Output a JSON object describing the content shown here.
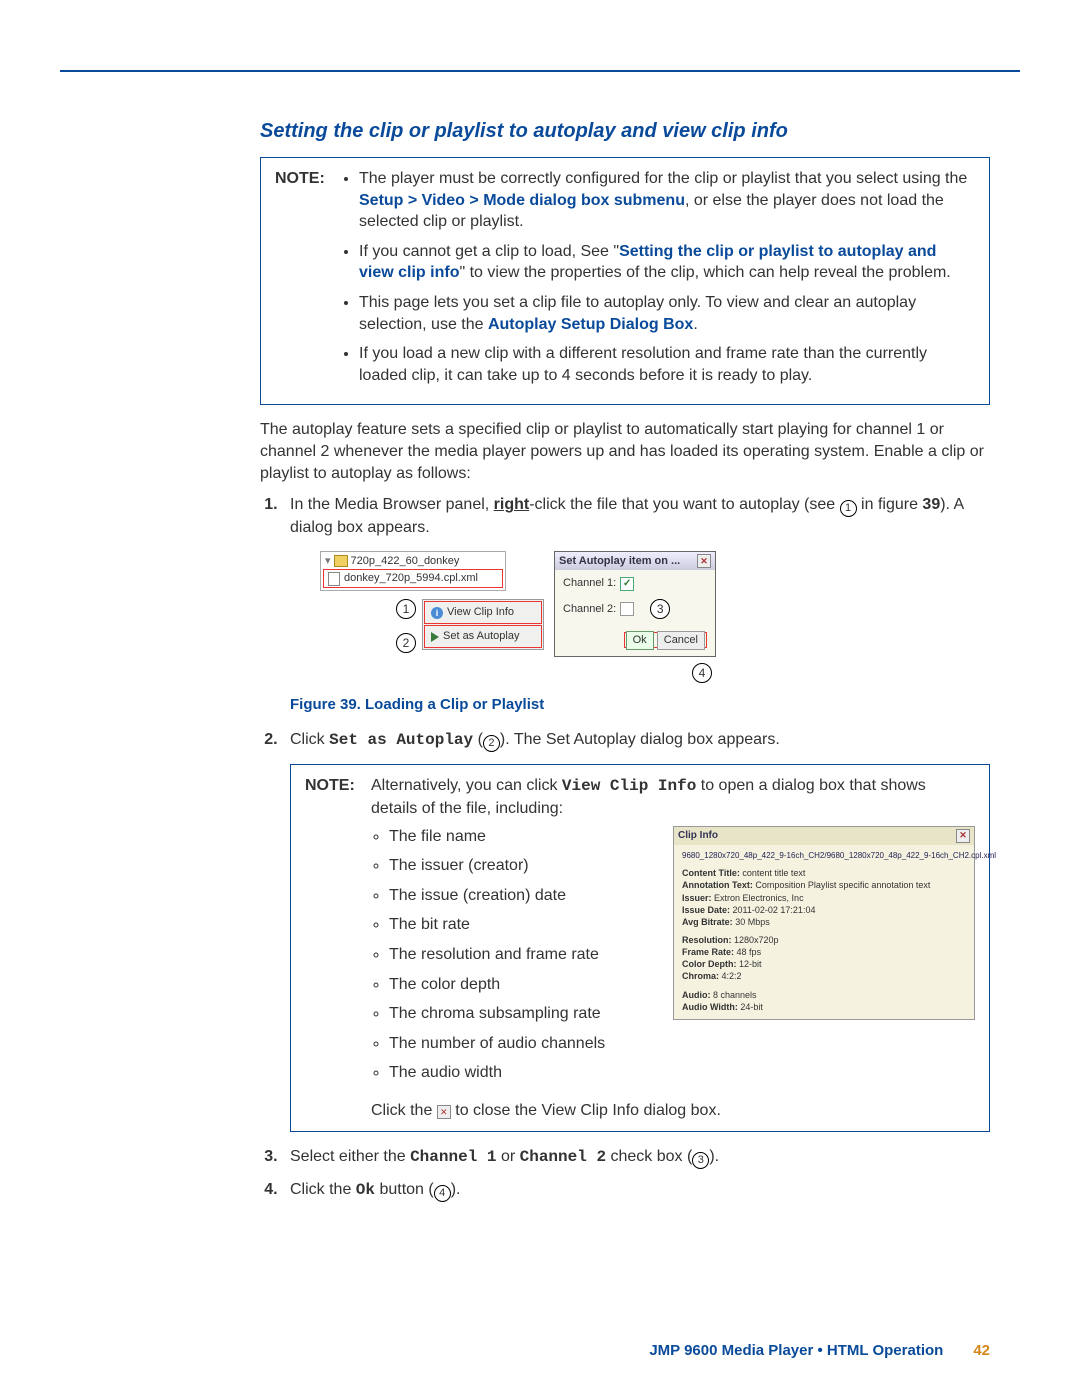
{
  "section_title": "Setting the clip or playlist to autoplay and view clip info",
  "note1": {
    "label": "NOTE:",
    "items": [
      {
        "pre": "The player must be correctly configured for the clip or playlist that you select using the ",
        "blue": "Setup > Video > Mode dialog box submenu",
        "post": ", or else the player does not load the selected clip or playlist."
      },
      {
        "pre": "If you cannot get a clip to load, See \"",
        "blue": "Setting the clip or playlist to autoplay and view clip info",
        "post": "\" to view the properties of the clip, which can help reveal the problem."
      },
      {
        "pre": "This page lets you set a clip file to autoplay only. To view and clear an autoplay selection, use the ",
        "blue": "Autoplay Setup Dialog Box",
        "post": "."
      },
      {
        "pre": "If you load a new clip with a different resolution and frame rate than the currently loaded clip, it can take up to 4 seconds before it is ready to play.",
        "blue": "",
        "post": ""
      }
    ]
  },
  "intro_paragraph": "The autoplay feature sets a specified clip or playlist to automatically start playing for channel 1 or channel 2 whenever the media player powers up and has loaded its operating system. Enable a clip or playlist to autoplay as follows:",
  "step1": {
    "pre": "In the Media Browser panel, ",
    "bold": "right",
    "mid": "-click the file that you want to autoplay (see ",
    "callout": "1",
    "post": " in figure ",
    "fig": "39",
    "end": "). A dialog box appears."
  },
  "tree": {
    "folder": "720p_422_60_donkey",
    "file": "donkey_720p_5994.cpl.xml"
  },
  "ctx": {
    "view": "View Clip Info",
    "autoplay": "Set as Autoplay"
  },
  "dialog": {
    "title": "Set Autoplay item on ...",
    "ch1": "Channel 1:",
    "ch2": "Channel 2:",
    "ok": "Ok",
    "cancel": "Cancel"
  },
  "figure_caption": "Figure 39. Loading a Clip or Playlist",
  "step2": {
    "pre": "Click ",
    "mono": "Set as Autoplay",
    "mid": " (",
    "callout": "2",
    "post": "). The Set Autoplay dialog box appears."
  },
  "note2": {
    "label": "NOTE:",
    "intro_pre": "Alternatively, you can click ",
    "intro_mono": "View Clip Info",
    "intro_post": " to open a dialog box that shows details of the file, including:",
    "bullets": [
      "The file name",
      "The issuer (creator)",
      "The issue (creation) date",
      "The bit rate",
      "The resolution and frame rate",
      "The color depth",
      "The chroma subsampling rate",
      "The number of audio channels",
      "The audio width"
    ],
    "close_line_pre": "Click the ",
    "close_line_post": " to close the View Clip Info dialog box."
  },
  "clipinfo": {
    "title": "Clip Info",
    "path": "9680_1280x720_48p_422_9-16ch_CH2/9680_1280x720_48p_422_9-16ch_CH2.cpl.xml",
    "content_title": "content title text",
    "annotation": "Composition Playlist specific annotation text",
    "issuer": "Extron Electronics, Inc",
    "issue_date": "2011-02-02 17:21:04",
    "bitrate": "30 Mbps",
    "resolution": "1280x720p",
    "framerate": "48 fps",
    "colordepth": "12-bit",
    "chroma": "4:2:2",
    "audio": "8 channels",
    "audiowidth": "24-bit"
  },
  "labels": {
    "content_title": "Content Title:",
    "annotation": "Annotation Text:",
    "issuer": "Issuer:",
    "issue_date": "Issue Date:",
    "bitrate": "Avg Bitrate:",
    "resolution": "Resolution:",
    "framerate": "Frame Rate:",
    "colordepth": "Color Depth:",
    "chroma": "Chroma:",
    "audio": "Audio:",
    "audiowidth": "Audio Width:"
  },
  "step3": {
    "pre": "Select either the ",
    "mono1": "Channel 1",
    "mid": " or ",
    "mono2": "Channel 2",
    "post": " check box (",
    "callout": "3",
    "end": ")."
  },
  "step4": {
    "pre": "Click the ",
    "mono": "Ok",
    "post": " button (",
    "callout": "4",
    "end": ")."
  },
  "footer": {
    "title": "JMP 9600 Media Player • HTML Operation",
    "page": "42"
  }
}
